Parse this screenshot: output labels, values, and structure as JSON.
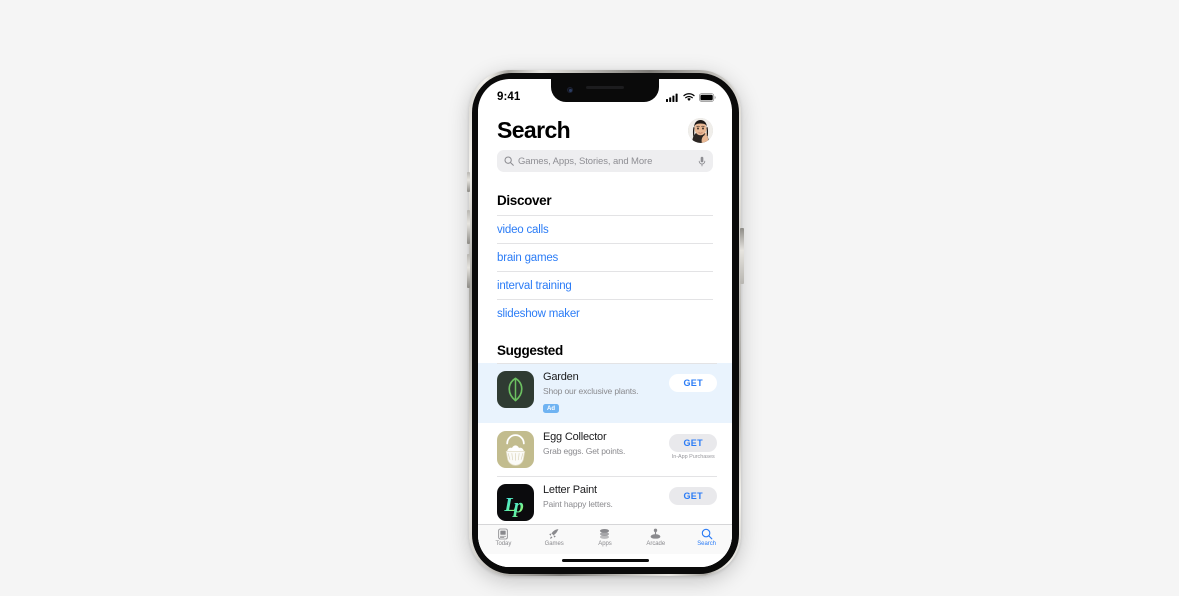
{
  "page": {
    "background_color": "#f5f5f5",
    "device": "iphone"
  },
  "status_bar": {
    "time": "9:41",
    "cellular_icon": "cellular-signal-icon",
    "wifi_icon": "wifi-icon",
    "battery_icon": "battery-icon"
  },
  "header": {
    "title": "Search",
    "avatar_label": "profile-avatar"
  },
  "search": {
    "placeholder": "Games, Apps, Stories, and More",
    "value": "",
    "search_icon": "search-icon",
    "mic_icon": "microphone-icon"
  },
  "discover": {
    "heading": "Discover",
    "items": [
      {
        "label": "video calls"
      },
      {
        "label": "brain games"
      },
      {
        "label": "interval training"
      },
      {
        "label": "slideshow maker"
      }
    ]
  },
  "suggested": {
    "heading": "Suggested",
    "apps": [
      {
        "name": "Garden",
        "subtitle": "Shop our exclusive plants.",
        "badge": "Ad",
        "action_label": "GET",
        "iap_note": "",
        "is_ad": true,
        "icon_name": "garden-leaf-app-icon",
        "icon_bg": "#2f3b32",
        "icon_fg": "#6cc061"
      },
      {
        "name": "Egg Collector",
        "subtitle": "Grab eggs. Get points.",
        "badge": "",
        "action_label": "GET",
        "iap_note": "In-App Purchases",
        "is_ad": false,
        "icon_name": "egg-basket-app-icon",
        "icon_bg": "#c2bc8e",
        "icon_fg": "#ffffff"
      },
      {
        "name": "Letter Paint",
        "subtitle": "Paint happy letters.",
        "badge": "",
        "action_label": "GET",
        "iap_note": "",
        "is_ad": false,
        "icon_name": "letter-paint-app-icon",
        "icon_bg": "#0b0b0d",
        "icon_fg": "#4fe0c0"
      }
    ]
  },
  "tab_bar": {
    "tabs": [
      {
        "label": "Today",
        "icon": "today-card-icon",
        "active": false
      },
      {
        "label": "Games",
        "icon": "rocket-icon",
        "active": false
      },
      {
        "label": "Apps",
        "icon": "stacked-apps-icon",
        "active": false
      },
      {
        "label": "Arcade",
        "icon": "arcade-joystick-icon",
        "active": false
      },
      {
        "label": "Search",
        "icon": "search-icon",
        "active": true
      }
    ],
    "active_color": "#2b7cf6",
    "inactive_color": "#8a8a8e"
  }
}
